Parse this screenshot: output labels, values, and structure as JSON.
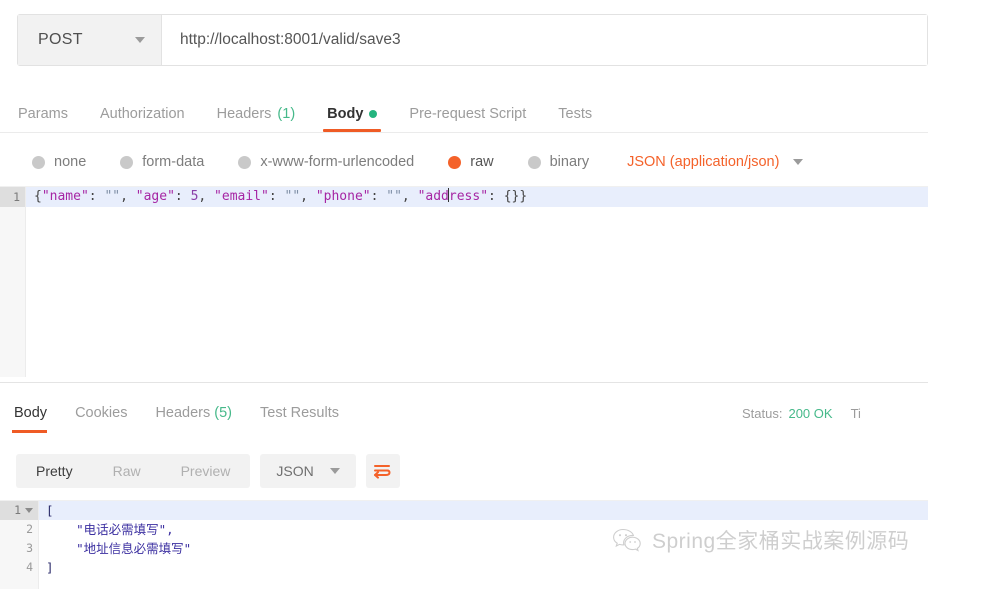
{
  "request": {
    "method": "POST",
    "method_caret": "chevron-down-icon",
    "url": "http://localhost:8001/valid/save3",
    "tabs": [
      {
        "label": "Params",
        "active": false,
        "count": ""
      },
      {
        "label": "Authorization",
        "active": false,
        "count": ""
      },
      {
        "label": "Headers",
        "active": false,
        "count": "(1)"
      },
      {
        "label": "Body",
        "active": true,
        "count": ""
      },
      {
        "label": "Pre-request Script",
        "active": false,
        "count": ""
      },
      {
        "label": "Tests",
        "active": false,
        "count": ""
      }
    ],
    "body_types": [
      {
        "label": "none",
        "selected": false
      },
      {
        "label": "form-data",
        "selected": false
      },
      {
        "label": "x-www-form-urlencoded",
        "selected": false
      },
      {
        "label": "raw",
        "selected": true
      },
      {
        "label": "binary",
        "selected": false
      }
    ],
    "content_type": "JSON (application/json)",
    "editor": {
      "line_number": "1",
      "tokens": [
        {
          "text": "{",
          "type": "punct"
        },
        {
          "text": "\"name\"",
          "type": "key"
        },
        {
          "text": ": ",
          "type": "punct"
        },
        {
          "text": "\"\"",
          "type": "str"
        },
        {
          "text": ", ",
          "type": "punct"
        },
        {
          "text": "\"age\"",
          "type": "key"
        },
        {
          "text": ": ",
          "type": "punct"
        },
        {
          "text": "5",
          "type": "num"
        },
        {
          "text": ", ",
          "type": "punct"
        },
        {
          "text": "\"email\"",
          "type": "key"
        },
        {
          "text": ": ",
          "type": "punct"
        },
        {
          "text": "\"\"",
          "type": "str"
        },
        {
          "text": ", ",
          "type": "punct"
        },
        {
          "text": "\"phone\"",
          "type": "key"
        },
        {
          "text": ": ",
          "type": "punct"
        },
        {
          "text": "\"\"",
          "type": "str"
        },
        {
          "text": ", ",
          "type": "punct"
        },
        {
          "text": "\"add",
          "type": "key"
        },
        {
          "text": "|CARET|",
          "type": "caret"
        },
        {
          "text": "ress\"",
          "type": "key"
        },
        {
          "text": ": ",
          "type": "punct"
        },
        {
          "text": "{}}",
          "type": "punct"
        }
      ],
      "plain_text": "{\"name\": \"\", \"age\": 5, \"email\": \"\", \"phone\": \"\", \"address\": {}}"
    }
  },
  "response": {
    "tabs": [
      {
        "label": "Body",
        "active": true,
        "count": ""
      },
      {
        "label": "Cookies",
        "active": false,
        "count": ""
      },
      {
        "label": "Headers",
        "active": false,
        "count": "(5)"
      },
      {
        "label": "Test Results",
        "active": false,
        "count": ""
      }
    ],
    "meta": {
      "status_label": "Status:",
      "status_value": "200 OK",
      "time_label_truncated": "Ti"
    },
    "toolbar": {
      "view_modes": [
        {
          "label": "Pretty",
          "active": true
        },
        {
          "label": "Raw",
          "active": false
        },
        {
          "label": "Preview",
          "active": false
        }
      ],
      "format": "JSON",
      "format_caret": "chevron-down-icon",
      "wrap_button": "word-wrap-icon"
    },
    "body_lines": [
      {
        "num": "1",
        "text": "[",
        "foldable": true
      },
      {
        "num": "2",
        "text": "    \"电话必需填写\",",
        "foldable": false
      },
      {
        "num": "3",
        "text": "    \"地址信息必需填写\"",
        "foldable": false
      },
      {
        "num": "4",
        "text": "]",
        "foldable": false
      }
    ]
  },
  "watermark": {
    "icon": "wechat-icon",
    "text": "Spring全家桶实战案例源码"
  },
  "colors": {
    "accent_orange": "#ef5b25",
    "radio_selected": "#f4622a",
    "status_green": "#46b98a",
    "dot_green": "#24b47e",
    "editor_active_line": "#e8eefc"
  }
}
